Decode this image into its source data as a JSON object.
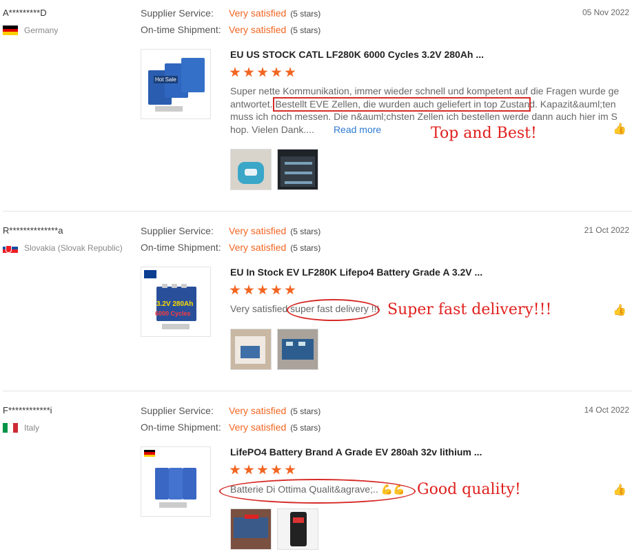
{
  "labels": {
    "supplier": "Supplier Service:",
    "shipment": "On-time Shipment:"
  },
  "reviews": [
    {
      "buyer": "A*********D",
      "country": "Germany",
      "date": "05 Nov 2022",
      "supplier_rating": "Very satisfied",
      "supplier_stars": "(5 stars)",
      "shipment_rating": "Very satisfied",
      "shipment_stars": "(5 stars)",
      "product_title": "EU US STOCK CATL LF280K 6000 Cycles 3.2V 280Ah ...",
      "body_lines": [
        "Super nette Kommunikation, immer wieder schnell und kompetent auf die Fragen wurde ge",
        "antwortet. Bestellt EVE Zellen, die wurden auch geliefert in top Zustand. Kapazit&auml;ten",
        "muss ich noch  messen. Die n&auml;chsten Zellen ich bestellen werde dann auch hier im S",
        "hop. Vielen Dank...."
      ],
      "read_more": "Read more",
      "annotation": "Top and Best!",
      "thumb_label": "Hot Sale"
    },
    {
      "buyer": "R**************a",
      "country": "Slovakia (Slovak Republic)",
      "date": "21 Oct 2022",
      "supplier_rating": "Very satisfied",
      "supplier_stars": "(5 stars)",
      "shipment_rating": "Very satisfied",
      "shipment_stars": "(5 stars)",
      "product_title": "EU In Stock EV LF280K Lifepo4 Battery Grade A 3.2V ...",
      "body_lines": [
        "Very satisfied super fast delivery !!!"
      ],
      "annotation": "Super fast delivery!!!",
      "thumb_label": "3.2V 280Ah",
      "thumb_label2": "6000 Cycles"
    },
    {
      "buyer": "F************i",
      "country": "Italy",
      "date": "14 Oct 2022",
      "supplier_rating": "Very satisfied",
      "supplier_stars": "(5 stars)",
      "shipment_rating": "Very satisfied",
      "shipment_stars": "(5 stars)",
      "product_title": "LifePO4 Battery Brand A Grade EV 280ah 32v lithium ...",
      "body_lines": [
        "Batterie Di Ottima Qualit&agrave;.."
      ],
      "emoji": "💪💪",
      "annotation": "Good quality!"
    }
  ],
  "icons": {
    "like": "thumbs-up-icon",
    "star": "star-icon"
  },
  "colors": {
    "accent": "#f26522",
    "annotation": "#e0201d",
    "link": "#2e7bd0"
  }
}
